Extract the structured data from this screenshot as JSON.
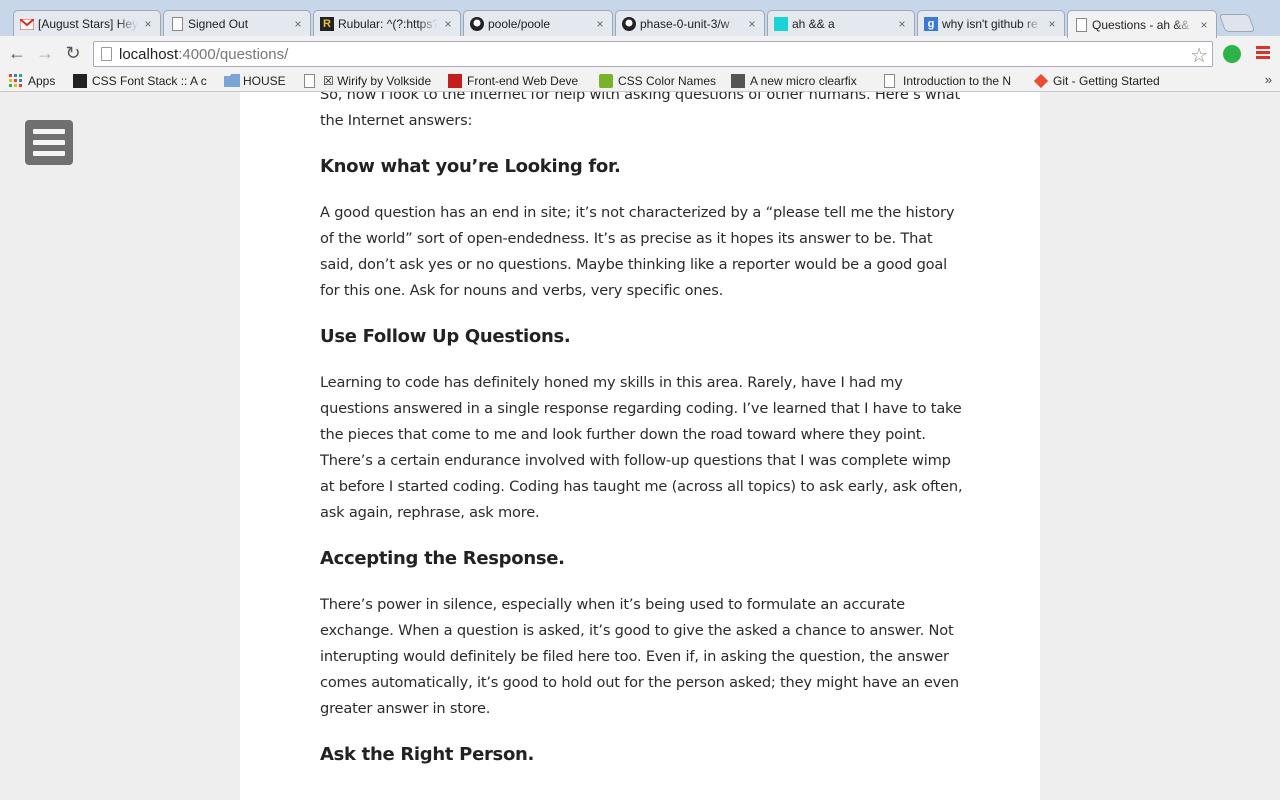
{
  "browser": {
    "tabs": [
      {
        "title": "[August Stars] Hey",
        "icon": "gmail-icon",
        "active": false
      },
      {
        "title": "Signed Out",
        "icon": "page-icon",
        "active": false
      },
      {
        "title": "Rubular: ^(?:https?",
        "icon": "rubular-icon",
        "active": false
      },
      {
        "title": "poole/poole",
        "icon": "github-icon",
        "active": false
      },
      {
        "title": "phase-0-unit-3/w",
        "icon": "github-icon",
        "active": false
      },
      {
        "title": "ah && a",
        "icon": "blog-icon",
        "active": false
      },
      {
        "title": "why isn't github re",
        "icon": "google-icon",
        "active": false
      },
      {
        "title": "Questions - ah &&",
        "icon": "page-icon",
        "active": true
      }
    ],
    "close_glyph": "×",
    "url_host": "localhost",
    "url_path": ":4000/questions/",
    "nav": {
      "back": "←",
      "forward": "→",
      "reload": "↻"
    },
    "star_glyph": "☆",
    "bookmarks": [
      {
        "label": "Apps",
        "icon": "apps-grid-icon"
      },
      {
        "label": "CSS Font Stack :: A c",
        "icon": "fontstack-icon"
      },
      {
        "label": "HOUSE",
        "icon": "folder-icon"
      },
      {
        "label": "☒ Wirify by Volkside",
        "icon": "page-icon"
      },
      {
        "label": "Front-end Web Deve",
        "icon": "frontend-icon"
      },
      {
        "label": "CSS Color Names",
        "icon": "w3-icon"
      },
      {
        "label": "A new micro clearfix",
        "icon": "avatar-icon"
      },
      {
        "label": "Introduction to the N",
        "icon": "page-icon"
      },
      {
        "label": "Git - Getting Started",
        "icon": "git-icon"
      }
    ],
    "bookmarks_overflow": "»",
    "colors": {
      "accent_green": "#2db34a",
      "menu_red": "#d9342b"
    }
  },
  "article": {
    "intro": "So, how I look to the Internet for help with asking questions of other humans. Here’s what the Internet answers:",
    "sections": [
      {
        "heading": "Know what you’re Looking for.",
        "body": "A good question has an end in site; it’s not characterized by a “please tell me the history of the world” sort of open-endedness. It’s as precise as it hopes its answer to be. That said, don’t ask yes or no questions. Maybe thinking like a reporter would be a good goal for this one. Ask for nouns and verbs, very specific ones."
      },
      {
        "heading": "Use Follow Up Questions.",
        "body": "Learning to code has definitely honed my skills in this area. Rarely, have I had my questions answered in a single response regarding coding. I’ve learned that I have to take the pieces that come to me and look further down the road toward where they point. There’s a certain endurance involved with follow-up questions that I was complete wimp at before I started coding. Coding has taught me (across all topics) to ask early, ask often, ask again, rephrase, ask more."
      },
      {
        "heading": "Accepting the Response.",
        "body": "There’s power in silence, especially when it’s being used to formulate an accurate exchange. When a question is asked, it’s good to give the asked a chance to answer. Not interupting would definitely be filed here too. Even if, in asking the question, the answer comes automatically, it’s good to hold out for the person asked; they might have an even greater answer in store."
      },
      {
        "heading": "Ask the Right Person.",
        "body": ""
      }
    ]
  }
}
